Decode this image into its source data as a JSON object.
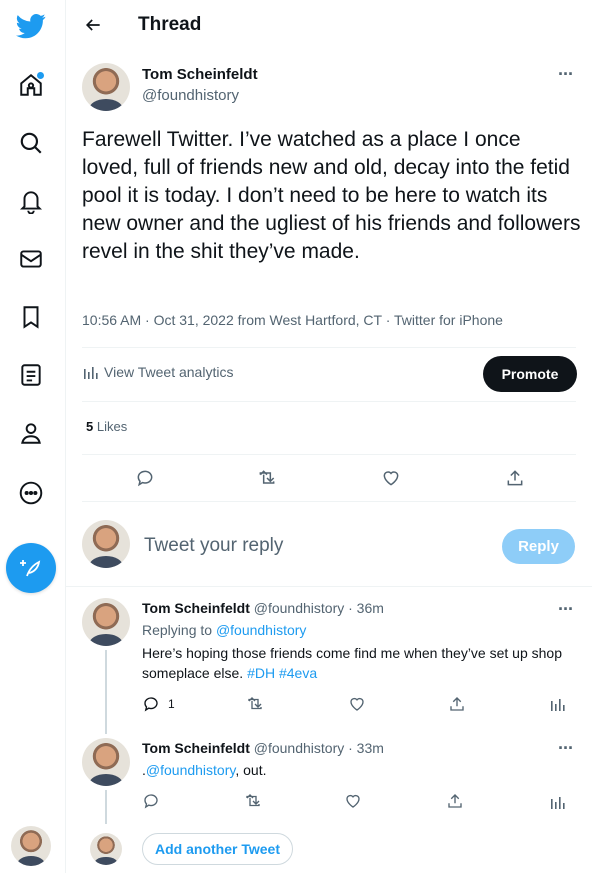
{
  "header": {
    "title": "Thread"
  },
  "tweet": {
    "author_name": "Tom Scheinfeldt",
    "author_handle": "@foundhistory",
    "text": "Farewell Twitter. I’ve watched as a place I once loved, full of friends new and old, decay into the fetid pool it is today. I don’t need to be here to watch its new owner and the ugliest of his friends and followers revel in the shit they’ve made.",
    "meta": "10:56 AM · Oct 31, 2022 from West Hartford, CT · Twitter for iPhone",
    "analytics_label": "View Tweet analytics",
    "promote_label": "Promote",
    "likes_count": "5",
    "likes_label": "Likes"
  },
  "compose": {
    "placeholder": "Tweet your reply",
    "reply_label": "Reply"
  },
  "replies": [
    {
      "name": "Tom Scheinfeldt",
      "handle_time": "@foundhistory · 36m",
      "replying_to_label": "Replying to",
      "replying_to_handle": "@foundhistory",
      "text": "Here’s hoping those friends come find me when they’ve set up shop someplace else.",
      "hashtags": "#DH #4eva",
      "reply_count": "1"
    },
    {
      "name": "Tom Scheinfeldt",
      "handle_time": "@foundhistory · 33m",
      "prefix": ".",
      "mention": "@foundhistory",
      "suffix": ", out."
    }
  ],
  "add_another": "Add another Tweet",
  "more_glyph": "···",
  "colors": {
    "accent": "#1d9bf0",
    "text": "#0f1419",
    "muted": "#536471"
  }
}
